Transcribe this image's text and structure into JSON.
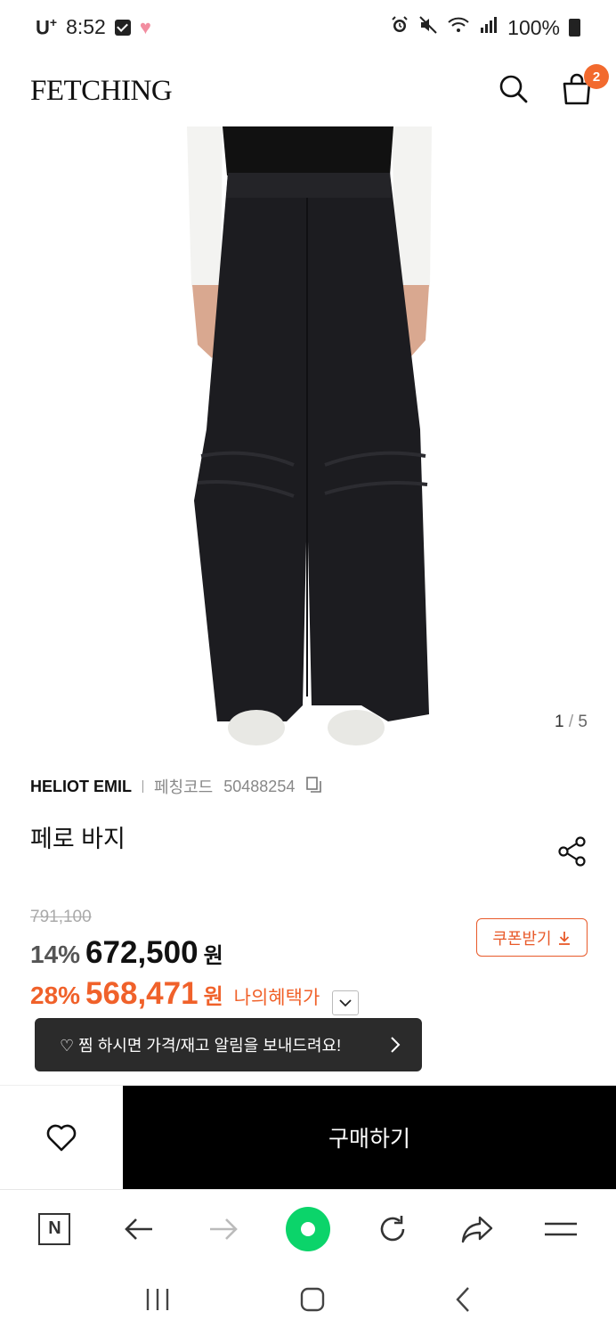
{
  "status_bar": {
    "carrier": "U",
    "carrier_sup": "+",
    "time": "8:52",
    "battery": "100%"
  },
  "header": {
    "logo": "FETCHING",
    "cart_count": "2"
  },
  "gallery": {
    "current": "1",
    "separator": "/",
    "total": "5"
  },
  "product": {
    "brand": "HELIOT EMIL",
    "code_label": "페칭코드",
    "code": "50488254",
    "title": "페로 바지",
    "original_price": "791,100",
    "discount_pct": "14%",
    "price": "672,500",
    "currency": "원",
    "member_pct": "28%",
    "member_price": "568,471",
    "member_currency": "원",
    "benefit_label": "나의혜택가",
    "coupon_label": "쿠폰받기"
  },
  "toast": {
    "text": "♡ 찜 하시면 가격/재고 알림을 보내드려요!"
  },
  "purchase": {
    "buy_label": "구매하기"
  },
  "colors": {
    "accent": "#f0612a",
    "toast_bg": "#2b2b2b",
    "browser_green": "#0bd46a"
  }
}
